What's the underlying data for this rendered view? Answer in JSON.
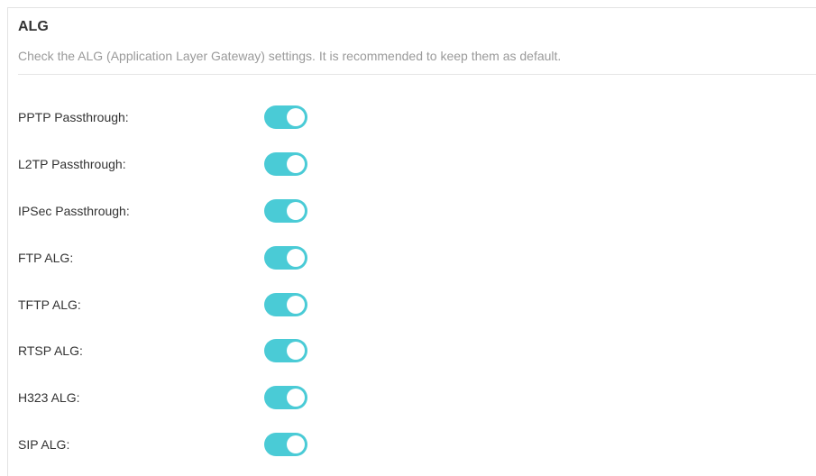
{
  "section": {
    "title": "ALG",
    "description": "Check the ALG (Application Layer Gateway) settings. It is recommended to keep them as default."
  },
  "colors": {
    "toggle_on": "#4acbd6"
  },
  "settings": [
    {
      "label": "PPTP Passthrough:",
      "enabled": true
    },
    {
      "label": "L2TP Passthrough:",
      "enabled": true
    },
    {
      "label": "IPSec Passthrough:",
      "enabled": true
    },
    {
      "label": "FTP ALG:",
      "enabled": true
    },
    {
      "label": "TFTP ALG:",
      "enabled": true
    },
    {
      "label": "RTSP ALG:",
      "enabled": true
    },
    {
      "label": "H323 ALG:",
      "enabled": true
    },
    {
      "label": "SIP ALG:",
      "enabled": true
    }
  ]
}
